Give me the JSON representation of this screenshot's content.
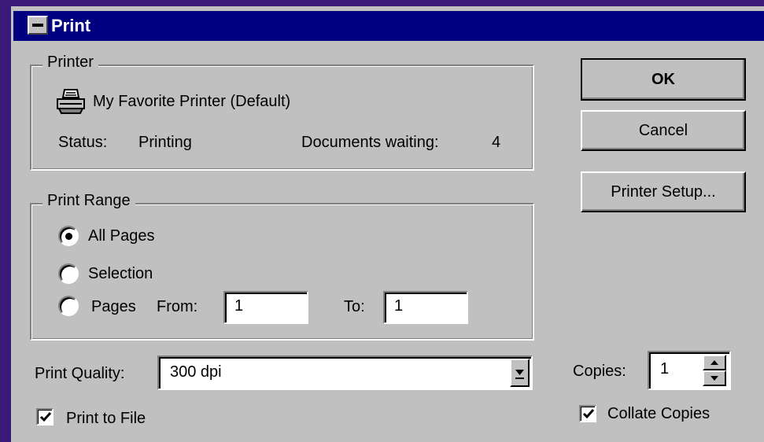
{
  "window": {
    "title": "Print"
  },
  "printer": {
    "group_label": "Printer",
    "name": "My Favorite Printer (Default)",
    "status_label": "Status:",
    "status_value": "Printing",
    "docs_label": "Documents waiting:",
    "docs_value": "4"
  },
  "range": {
    "group_label": "Print Range",
    "all_pages": "All Pages",
    "selection": "Selection",
    "pages": "Pages",
    "from_label": "From:",
    "from_value": "1",
    "to_label": "To:",
    "to_value": "1",
    "selected": "all_pages"
  },
  "quality": {
    "label": "Print Quality:",
    "value": "300 dpi"
  },
  "print_to_file": {
    "label": "Print to File",
    "checked": true
  },
  "copies": {
    "label": "Copies:",
    "value": "1"
  },
  "collate": {
    "label": "Collate Copies",
    "checked": true
  },
  "buttons": {
    "ok": "OK",
    "cancel": "Cancel",
    "setup": "Printer Setup..."
  },
  "icons": {
    "printer": "printer-icon",
    "system_menu": "system-menu-icon"
  }
}
